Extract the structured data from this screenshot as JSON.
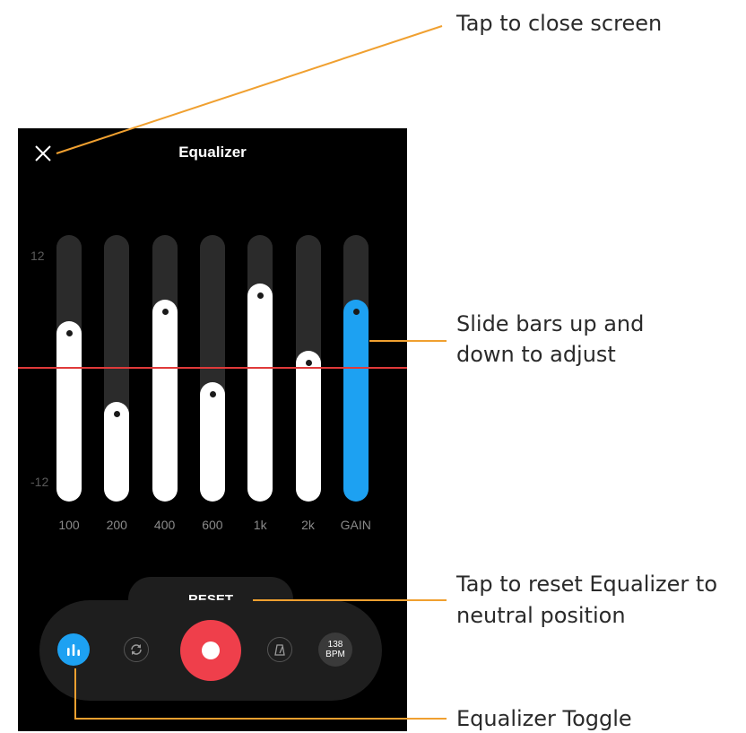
{
  "screen": {
    "title": "Equalizer",
    "scale_max": "12",
    "scale_min": "-12"
  },
  "bands": [
    {
      "label": "100",
      "level": 3.4
    },
    {
      "label": "200",
      "level": -4.6
    },
    {
      "label": "400",
      "level": 5.6
    },
    {
      "label": "600",
      "level": -2.6
    },
    {
      "label": "1k",
      "level": 7.2
    },
    {
      "label": "2k",
      "level": 0.5
    },
    {
      "label": "GAIN",
      "level": 5.6,
      "accent": true
    }
  ],
  "reset_label": "RESET",
  "toolbar": {
    "bpm_value": "138",
    "bpm_unit": "BPM"
  },
  "colors": {
    "accent": "#1da1f2",
    "record": "#ef3f4b",
    "zero_line": "#e03a3a",
    "annotation_line": "#f0a030"
  },
  "annotations": {
    "close": "Tap to close screen",
    "slide_line1": "Slide bars up and",
    "slide_line2": "down to adjust",
    "reset_line1": "Tap to reset Equalizer to",
    "reset_line2": "neutral position",
    "toggle": "Equalizer Toggle"
  }
}
